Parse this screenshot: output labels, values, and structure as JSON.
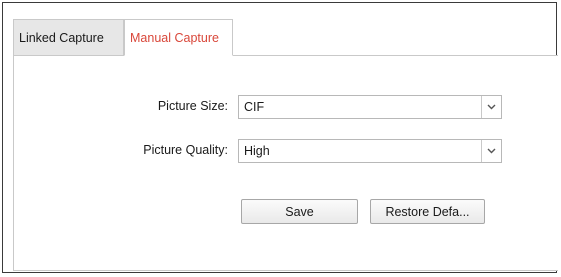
{
  "tabs": [
    {
      "label": "Linked Capture",
      "active": false
    },
    {
      "label": "Manual Capture",
      "active": true
    }
  ],
  "form": {
    "picture_size": {
      "label": "Picture Size:",
      "value": "CIF"
    },
    "picture_quality": {
      "label": "Picture Quality:",
      "value": "High"
    }
  },
  "buttons": {
    "save_label": "Save",
    "restore_label": "Restore Defa..."
  },
  "colors": {
    "active_tab_text": "#d9473a",
    "inactive_tab_bg": "#e7e7e7",
    "border": "#c9c9c9"
  },
  "icons": {
    "dropdown": "chevron-down-icon"
  }
}
